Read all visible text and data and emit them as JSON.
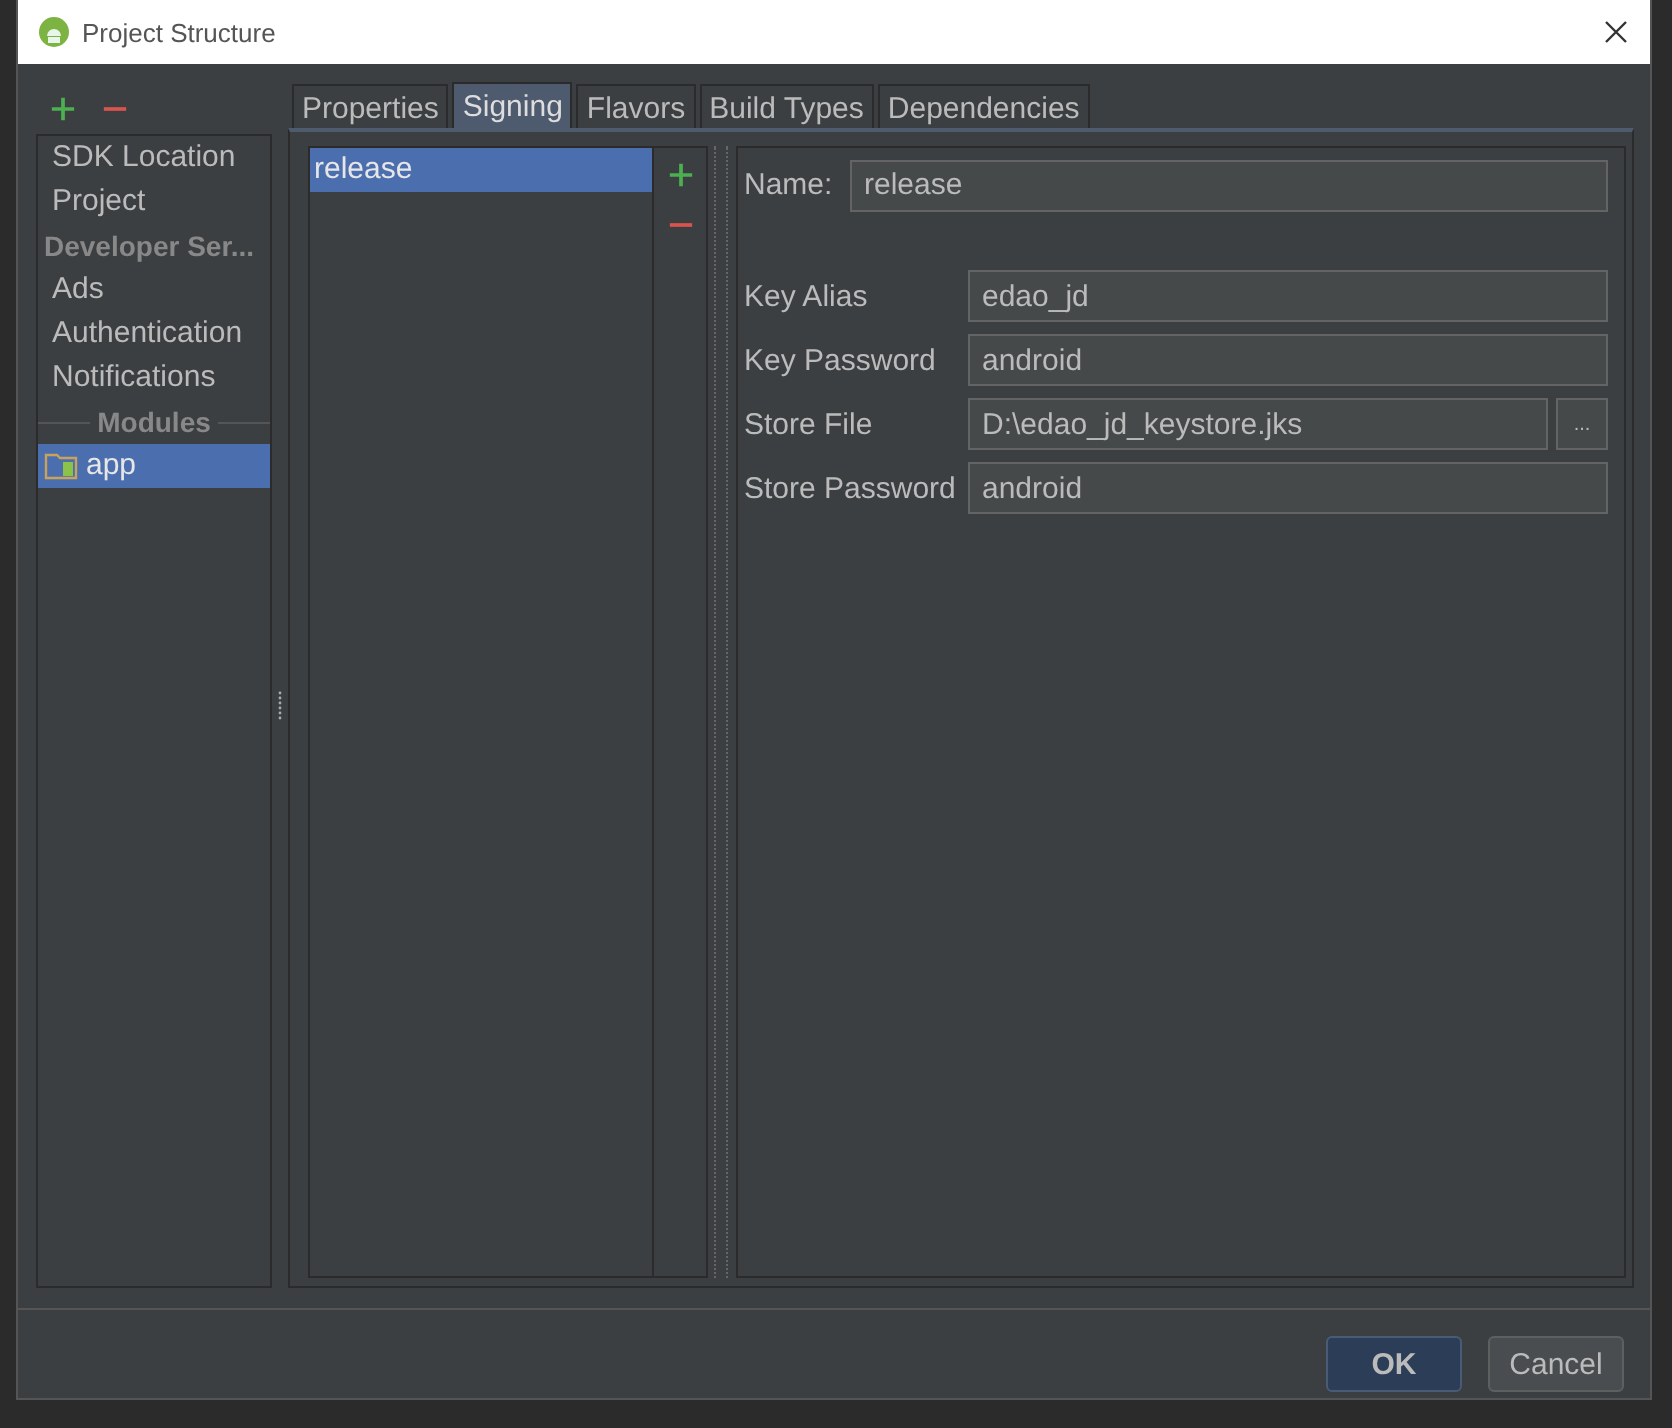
{
  "window": {
    "title": "Project Structure"
  },
  "sidebar": {
    "items": [
      {
        "label": "SDK Location",
        "kind": "item",
        "selected": false
      },
      {
        "label": "Project",
        "kind": "item",
        "selected": false
      },
      {
        "label": "Developer Ser...",
        "kind": "header"
      },
      {
        "label": "Ads",
        "kind": "item",
        "selected": false
      },
      {
        "label": "Authentication",
        "kind": "item",
        "selected": false
      },
      {
        "label": "Notifications",
        "kind": "item",
        "selected": false
      },
      {
        "label": "Modules",
        "kind": "separator"
      },
      {
        "label": "app",
        "kind": "module",
        "selected": true
      }
    ]
  },
  "tabs": [
    {
      "label": "Properties",
      "selected": false
    },
    {
      "label": "Signing",
      "selected": true
    },
    {
      "label": "Flavors",
      "selected": false
    },
    {
      "label": "Build Types",
      "selected": false
    },
    {
      "label": "Dependencies",
      "selected": false
    }
  ],
  "signing_configs": [
    {
      "name": "release",
      "selected": true
    }
  ],
  "form": {
    "name": {
      "label": "Name:",
      "value": "release"
    },
    "fields": [
      {
        "label": "Key Alias",
        "value": "edao_jd",
        "kind": "text"
      },
      {
        "label": "Key Password",
        "value": "android",
        "kind": "text"
      },
      {
        "label": "Store File",
        "value": "D:\\edao_jd_keystore.jks",
        "kind": "file",
        "browse": "..."
      },
      {
        "label": "Store Password",
        "value": "android",
        "kind": "text"
      }
    ]
  },
  "buttons": [
    {
      "label": "OK",
      "kind": "primary"
    },
    {
      "label": "Cancel",
      "kind": "secondary"
    }
  ]
}
